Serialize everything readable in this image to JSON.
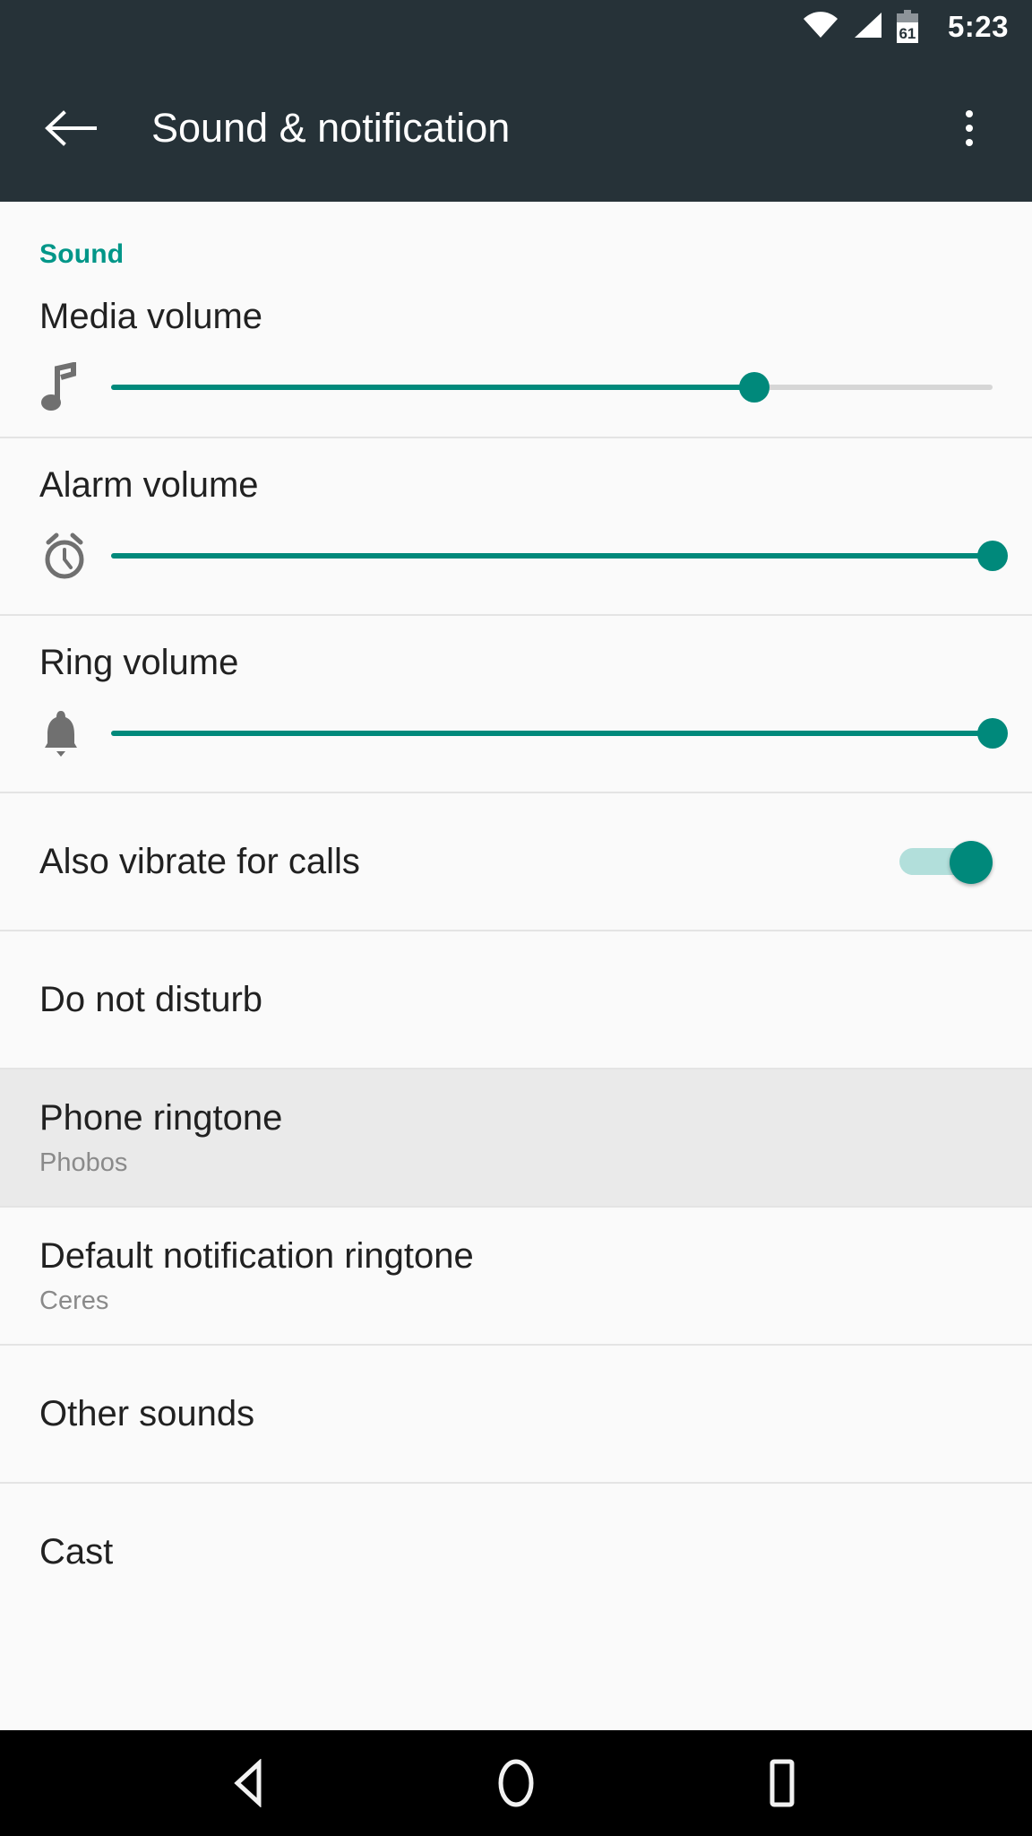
{
  "status_bar": {
    "time": "5:23",
    "battery_percent": "61",
    "icons": [
      "wifi-icon",
      "cellular-signal-icon",
      "battery-icon"
    ]
  },
  "app_bar": {
    "back_icon": "back-arrow-icon",
    "title": "Sound & notification",
    "overflow_icon": "overflow-menu-icon"
  },
  "colors": {
    "accent": "#009688",
    "slider_active": "#00897b",
    "appbar_bg": "#263238",
    "content_bg": "#fafafa",
    "selected_row_bg": "#eaeaea",
    "divider": "#e4e4e4"
  },
  "section": {
    "label": "Sound"
  },
  "sliders": [
    {
      "title": "Media volume",
      "icon": "music-note-icon",
      "value_percent": 73
    },
    {
      "title": "Alarm volume",
      "icon": "alarm-clock-icon",
      "value_percent": 100
    },
    {
      "title": "Ring volume",
      "icon": "bell-icon",
      "value_percent": 100
    }
  ],
  "items": [
    {
      "title": "Also vibrate for calls",
      "subtitle": "",
      "toggle": "on"
    },
    {
      "title": "Do not disturb",
      "subtitle": ""
    },
    {
      "title": "Phone ringtone",
      "subtitle": "Phobos",
      "selected": true
    },
    {
      "title": "Default notification ringtone",
      "subtitle": "Ceres"
    },
    {
      "title": "Other sounds",
      "subtitle": ""
    },
    {
      "title": "Cast",
      "subtitle": ""
    }
  ],
  "nav_bar": {
    "back": "nav-back-icon",
    "home": "nav-home-icon",
    "recents": "nav-recents-icon"
  }
}
